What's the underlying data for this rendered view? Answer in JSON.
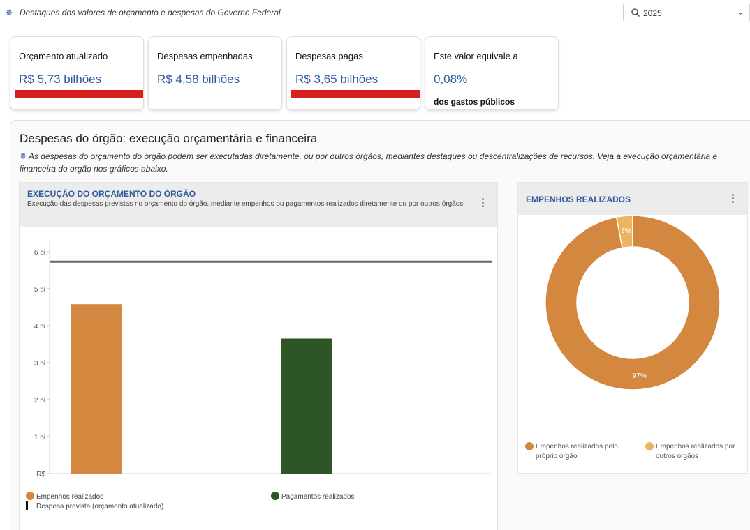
{
  "header": {
    "subtitle": "Destaques dos valores de orçamento e despesas do Governo Federal",
    "year_select": {
      "value": "2025",
      "icon": "search-icon"
    }
  },
  "cards": [
    {
      "label": "Orçamento atualizado",
      "value": "R$ 5,73 bilhões",
      "redbar": true
    },
    {
      "label": "Despesas empenhadas",
      "value": "R$ 4,58 bilhões",
      "redbar": false
    },
    {
      "label": "Despesas pagas",
      "value": "R$ 3,65 bilhões",
      "redbar": true
    },
    {
      "label": "Este valor equivale a",
      "value": "0,08%",
      "note": "dos gastos públicos",
      "redbar": false
    }
  ],
  "section": {
    "title": "Despesas do órgão: execução orçamentária e financeira",
    "description": "As despesas do orçamento do órgão podem ser executadas diretamente, ou por outros órgãos, mediantes destaques ou descentralizações de recursos. Veja a execução orçamentária e financeira do orgão nos gráficos abaixo."
  },
  "colors": {
    "empenhos": "#d4873e",
    "pagamentos": "#2d5526",
    "outros": "#ecb45e",
    "prevista": "#666666",
    "accent": "#2f5a9e",
    "red": "#d71f1f"
  },
  "chart_data": [
    {
      "type": "bar",
      "title": "EXECUÇÃO DO ORÇAMENTO DO ÓRGÃO",
      "subtitle": "Execução das despesas previstas no orçamento do órgão, mediante empenhos ou pagamentos realizados diretamente ou por outros órgãos.",
      "yticks": [
        "R$",
        "1 bi",
        "2 bi",
        "3 bi",
        "4 bi",
        "5 bi",
        "6 bi"
      ],
      "ylim": [
        0,
        6.3
      ],
      "series": [
        {
          "name": "Empenhos realizados",
          "value": 4.58
        },
        {
          "name": "Pagamentos realizados",
          "value": 3.65
        }
      ],
      "reference_line": {
        "name": "Despesa prevista (orçamento atualizado)",
        "value": 5.73
      },
      "grid": false,
      "legend_position": "bottom"
    },
    {
      "type": "pie",
      "title": "EMPENHOS REALIZADOS",
      "slices": [
        {
          "name": "Empenhos realizados pelo próprio órgão",
          "value": 97,
          "label": "97%"
        },
        {
          "name": "Empenhos realizados por outros órgãos",
          "value": 3,
          "label": "3%"
        }
      ],
      "legend_position": "bottom"
    }
  ]
}
